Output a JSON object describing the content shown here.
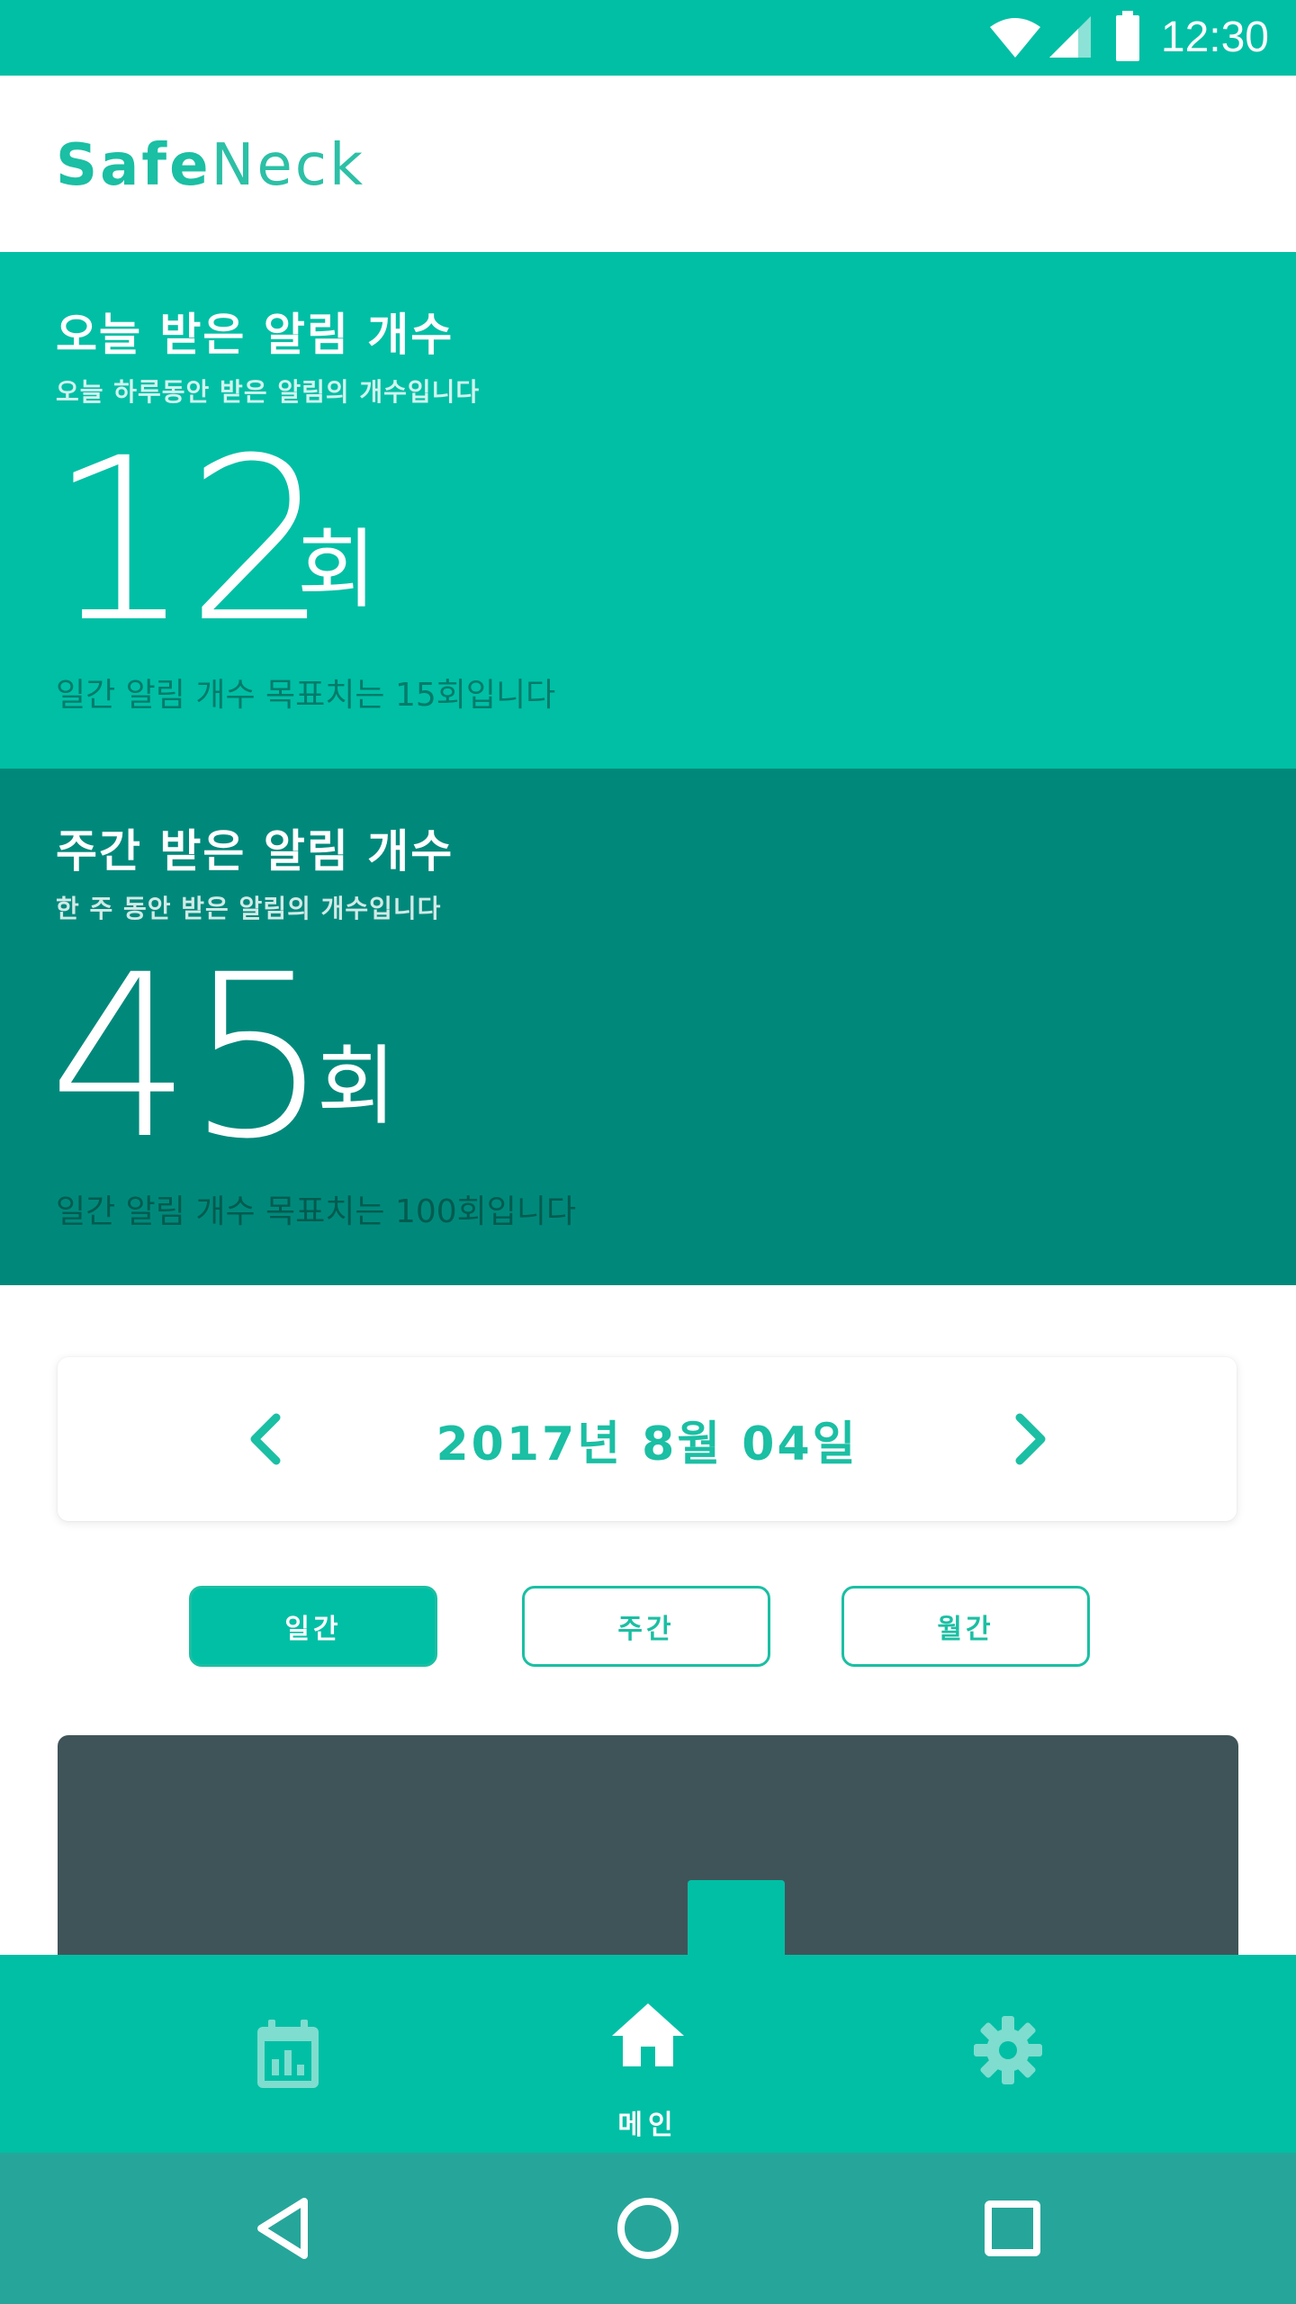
{
  "status_bar": {
    "time": "12:30",
    "icons": [
      "wifi-icon",
      "cell-signal-icon",
      "battery-icon"
    ]
  },
  "app": {
    "logo_bold": "Safe",
    "logo_light": "Neck"
  },
  "today": {
    "title": "오늘 받은 알림 개수",
    "subtitle": "오늘 하루동안 받은 알림의 개수입니다",
    "count": "12",
    "unit": "회",
    "goal_text": "일간 알림 개수 목표치는 15회입니다"
  },
  "weekly": {
    "title": "주간 받은 알림 개수",
    "subtitle": "한 주 동안 받은 알림의 개수입니다",
    "count": "45",
    "unit": "회",
    "goal_text": "일간 알림 개수 목표치는 100회입니다"
  },
  "date_selector": {
    "date": "2017년 8월 04일",
    "prev_icon": "chevron-left-icon",
    "next_icon": "chevron-right-icon"
  },
  "period_tabs": [
    {
      "label": "일간",
      "active": true
    },
    {
      "label": "주간",
      "active": false
    },
    {
      "label": "월간",
      "active": false
    }
  ],
  "chart": {
    "bar_fraction_visible": 0.3
  },
  "bottom_nav": {
    "items": [
      {
        "icon": "calendar-chart-icon",
        "label": ""
      },
      {
        "icon": "home-icon",
        "label": "메인",
        "active": true
      },
      {
        "icon": "gear-icon",
        "label": ""
      }
    ]
  },
  "system_nav": {
    "icons": [
      "back-icon",
      "home-circle-icon",
      "recents-icon"
    ]
  },
  "colors": {
    "primary": "#00BFA5",
    "primary_dark": "#00897B",
    "chart_bg": "#3F5459",
    "system_nav": "#26A69A"
  }
}
